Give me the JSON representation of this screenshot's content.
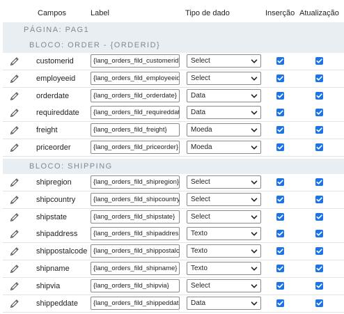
{
  "columns": {
    "campos": "Campos",
    "label": "Label",
    "tipo": "Tipo de dado",
    "insercao": "Inserção",
    "atualizacao": "Atualização"
  },
  "page_label": "PÁGINA: PAG1",
  "blocks": [
    {
      "title": "BLOCO: ORDER - {ORDERID}",
      "fields": [
        {
          "name": "customerid",
          "label": "{lang_orders_fild_customerid}",
          "type": "Select",
          "insert": true,
          "update": true
        },
        {
          "name": "employeeid",
          "label": "{lang_orders_fild_employeeid}",
          "type": "Select",
          "insert": true,
          "update": true
        },
        {
          "name": "orderdate",
          "label": "{lang_orders_fild_orderdate}",
          "type": "Data",
          "insert": true,
          "update": true
        },
        {
          "name": "requireddate",
          "label": "{lang_orders_fild_requireddate}",
          "type": "Data",
          "insert": true,
          "update": true
        },
        {
          "name": "freight",
          "label": "{lang_orders_fild_freight}",
          "type": "Moeda",
          "insert": true,
          "update": true
        },
        {
          "name": "priceorder",
          "label": "{lang_orders_fild_priceorder}",
          "type": "Moeda",
          "insert": true,
          "update": true
        }
      ]
    },
    {
      "title": "BLOCO: SHIPPING",
      "fields": [
        {
          "name": "shipregion",
          "label": "{lang_orders_fild_shipregion}",
          "type": "Select",
          "insert": true,
          "update": true
        },
        {
          "name": "shipcountry",
          "label": "{lang_orders_fild_shipcountry}",
          "type": "Select",
          "insert": true,
          "update": true
        },
        {
          "name": "shipstate",
          "label": "{lang_orders_fild_shipstate}",
          "type": "Select",
          "insert": true,
          "update": true
        },
        {
          "name": "shipaddress",
          "label": "{lang_orders_fild_shipaddress}",
          "type": "Texto",
          "insert": true,
          "update": true
        },
        {
          "name": "shippostalcode",
          "label": "{lang_orders_fild_shippostalcode}",
          "type": "Texto",
          "insert": true,
          "update": true
        },
        {
          "name": "shipname",
          "label": "{lang_orders_fild_shipname}",
          "type": "Texto",
          "insert": true,
          "update": true
        },
        {
          "name": "shipvia",
          "label": "{lang_orders_fild_shipvia}",
          "type": "Select",
          "insert": true,
          "update": true
        },
        {
          "name": "shippeddate",
          "label": "{lang_orders_fild_shippeddate}",
          "type": "Data",
          "insert": true,
          "update": true
        }
      ]
    }
  ],
  "icons": {
    "edit": "pencil-icon",
    "dropdown": "chevron-down-icon",
    "checkbox": "checkmark-icon"
  },
  "colors": {
    "section_bg": "#e9eef2",
    "section_text": "#7c8a96",
    "checkbox": "#1a73e8"
  }
}
